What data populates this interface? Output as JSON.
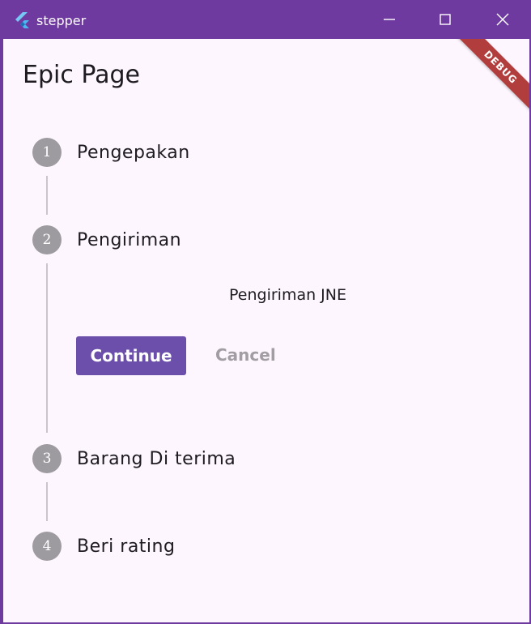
{
  "window": {
    "title": "stepper"
  },
  "appbar": {
    "title": "Epic Page"
  },
  "stepper": {
    "steps": [
      {
        "number": "1",
        "title": "Pengepakan"
      },
      {
        "number": "2",
        "title": "Pengiriman",
        "content": "Pengiriman JNE"
      },
      {
        "number": "3",
        "title": "Barang Di terima"
      },
      {
        "number": "4",
        "title": "Beri rating"
      }
    ],
    "continue_label": "Continue",
    "cancel_label": "Cancel"
  },
  "debug_banner": "DEBUG",
  "colors": {
    "titlebar": "#6e3a9f",
    "background": "#fdf6fe",
    "step_circle": "#9e9ba0",
    "primary_button": "#6b4faa",
    "debug_banner": "#b13d3d"
  },
  "icons": [
    "flutter-logo-icon",
    "minimize-icon",
    "maximize-icon",
    "close-icon"
  ]
}
